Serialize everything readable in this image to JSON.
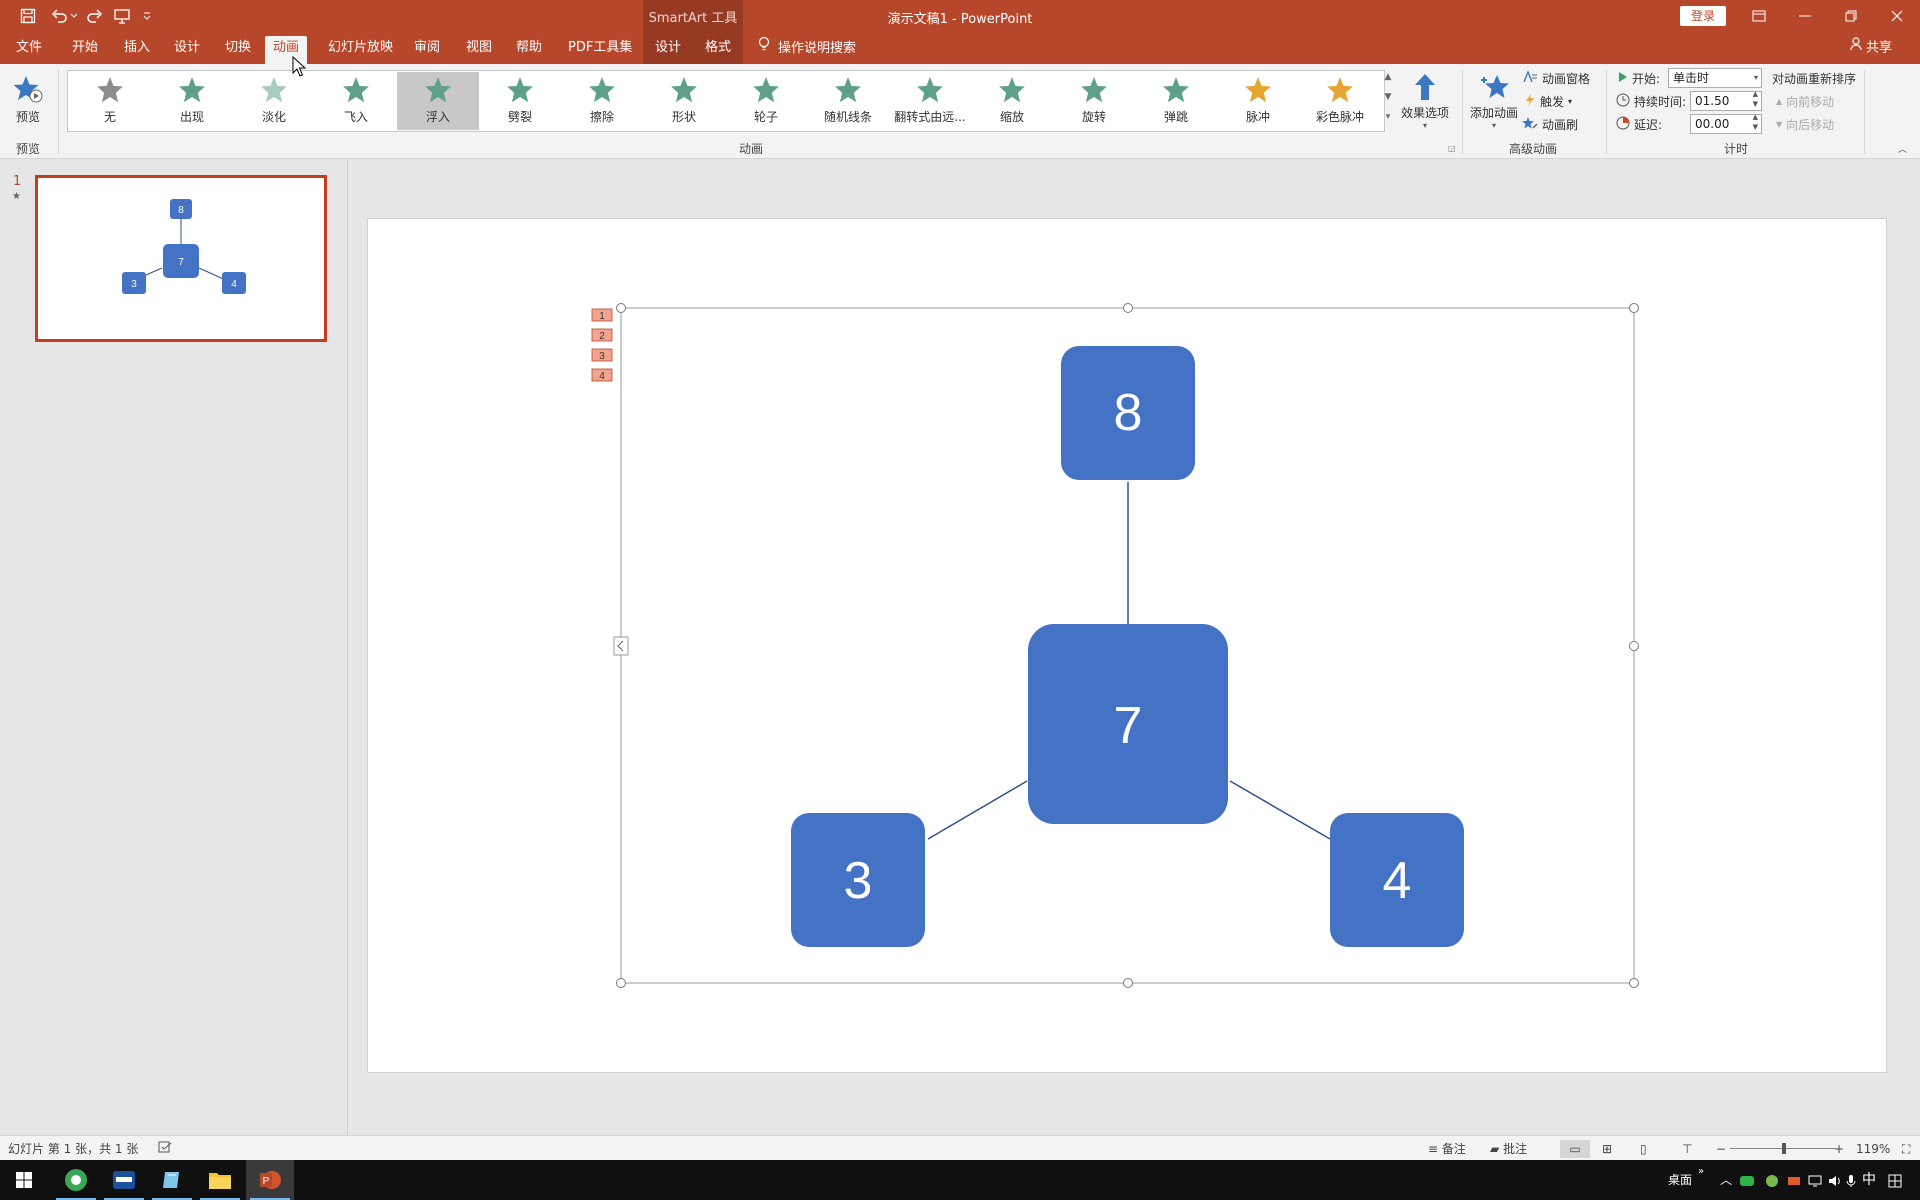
{
  "titlebar": {
    "context_tool": "SmartArt 工具",
    "doc_title": "演示文稿1  -  PowerPoint",
    "login": "登录"
  },
  "tabs": {
    "file": "文件",
    "home": "开始",
    "insert": "插入",
    "design": "设计",
    "transitions": "切换",
    "animations": "动画",
    "slideshow": "幻灯片放映",
    "review": "审阅",
    "view": "视图",
    "help": "帮助",
    "pdf": "PDF工具集",
    "sa_design": "设计",
    "sa_format": "格式",
    "tell_me": "操作说明搜索",
    "share": "共享"
  },
  "ribbon": {
    "preview": "预览",
    "preview_group": "预览",
    "animation_group": "动画",
    "effects": [
      "无",
      "出现",
      "淡化",
      "飞入",
      "浮入",
      "劈裂",
      "擦除",
      "形状",
      "轮子",
      "随机线条",
      "翻转式由远...",
      "缩放",
      "旋转",
      "弹跳",
      "脉冲",
      "彩色脉冲"
    ],
    "effect_options": "效果选项",
    "add_animation": "添加动画",
    "animation_pane": "动画窗格",
    "trigger": "触发",
    "animation_painter": "动画刷",
    "advanced_group": "高级动画",
    "start_label": "开始:",
    "start_value": "单击时",
    "duration_label": "持续时间:",
    "duration_value": "01.50",
    "delay_label": "延迟:",
    "delay_value": "00.00",
    "reorder": "对动画重新排序",
    "move_earlier": "向前移动",
    "move_later": "向后移动",
    "timing_group": "计时"
  },
  "thumbnails": {
    "slide_number": "1",
    "star": "★"
  },
  "smartart": {
    "top": "8",
    "center": "7",
    "left": "3",
    "right": "4",
    "box_color": "#4472c4",
    "anim_tags": [
      "1",
      "2",
      "3",
      "4"
    ]
  },
  "statusbar": {
    "slide_info": "幻灯片 第 1 张，共 1 张",
    "notes": "备注",
    "comments": "批注",
    "zoom": "119%"
  },
  "taskbar": {
    "desktop": "桌面",
    "ime": "中"
  },
  "colors": {
    "accent": "#b7472a",
    "star_green": "#5ea08a",
    "star_gray": "#8c8c8c",
    "star_gold": "#e5a532"
  }
}
